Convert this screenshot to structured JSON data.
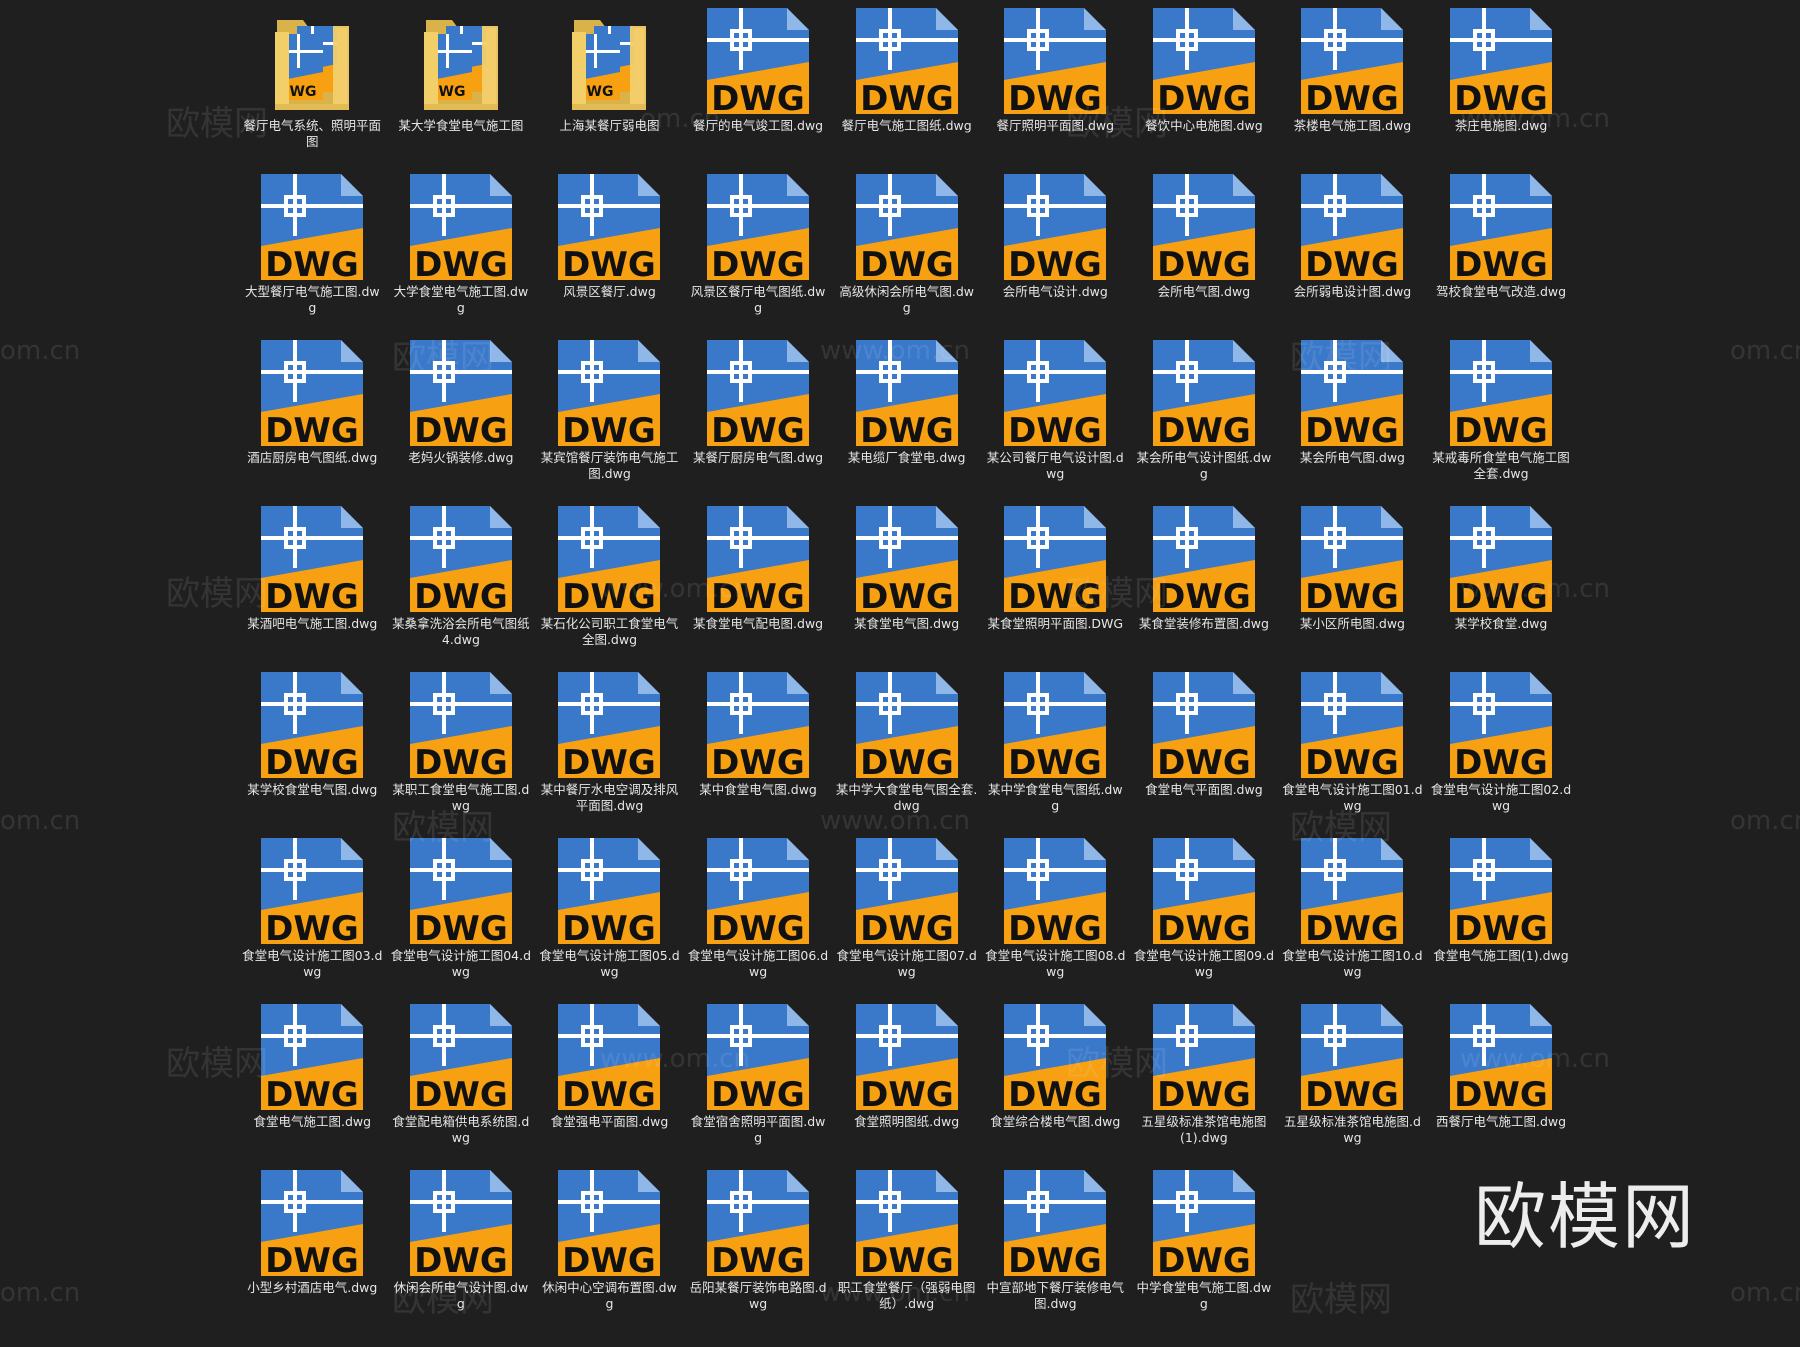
{
  "colors": {
    "background": "#1f1f1f",
    "dwg_blue": "#3a78c9",
    "dwg_orange": "#f7a012",
    "folder_yellow": "#f3cf6a"
  },
  "watermark": {
    "brand_text": "欧模网",
    "url_text": "www.om.cn",
    "url_fragment": "om.cn"
  },
  "files": [
    {
      "type": "folder",
      "name": "餐厅电气系统、照明平面图"
    },
    {
      "type": "folder",
      "name": "某大学食堂电气施工图"
    },
    {
      "type": "folder",
      "name": "上海某餐厅弱电图"
    },
    {
      "type": "dwg",
      "name": "餐厅的电气竣工图.dwg"
    },
    {
      "type": "dwg",
      "name": "餐厅电气施工图纸.dwg"
    },
    {
      "type": "dwg",
      "name": "餐厅照明平面图.dwg"
    },
    {
      "type": "dwg",
      "name": "餐饮中心电施图.dwg"
    },
    {
      "type": "dwg",
      "name": "茶楼电气施工图.dwg"
    },
    {
      "type": "dwg",
      "name": "茶庄电施图.dwg"
    },
    {
      "type": "dwg",
      "name": "大型餐厅电气施工图.dwg"
    },
    {
      "type": "dwg",
      "name": "大学食堂电气施工图.dwg"
    },
    {
      "type": "dwg",
      "name": "风景区餐厅.dwg"
    },
    {
      "type": "dwg",
      "name": "风景区餐厅电气图纸.dwg"
    },
    {
      "type": "dwg",
      "name": "高级休闲会所电气图.dwg"
    },
    {
      "type": "dwg",
      "name": "会所电气设计.dwg"
    },
    {
      "type": "dwg",
      "name": "会所电气图.dwg"
    },
    {
      "type": "dwg",
      "name": "会所弱电设计图.dwg"
    },
    {
      "type": "dwg",
      "name": "驾校食堂电气改造.dwg"
    },
    {
      "type": "dwg",
      "name": "酒店厨房电气图纸.dwg"
    },
    {
      "type": "dwg",
      "name": "老妈火锅装修.dwg"
    },
    {
      "type": "dwg",
      "name": "某宾馆餐厅装饰电气施工图.dwg"
    },
    {
      "type": "dwg",
      "name": "某餐厅厨房电气图.dwg"
    },
    {
      "type": "dwg",
      "name": "某电缆厂食堂电.dwg"
    },
    {
      "type": "dwg",
      "name": "某公司餐厅电气设计图.dwg"
    },
    {
      "type": "dwg",
      "name": "某会所电气设计图纸.dwg"
    },
    {
      "type": "dwg",
      "name": "某会所电气图.dwg"
    },
    {
      "type": "dwg",
      "name": "某戒毒所食堂电气施工图全套.dwg"
    },
    {
      "type": "dwg",
      "name": "某酒吧电气施工图.dwg"
    },
    {
      "type": "dwg",
      "name": "某桑拿洗浴会所电气图纸4.dwg"
    },
    {
      "type": "dwg",
      "name": "某石化公司职工食堂电气全图.dwg"
    },
    {
      "type": "dwg",
      "name": "某食堂电气配电图.dwg"
    },
    {
      "type": "dwg",
      "name": "某食堂电气图.dwg"
    },
    {
      "type": "dwg",
      "name": "某食堂照明平面图.DWG"
    },
    {
      "type": "dwg",
      "name": "某食堂装修布置图.dwg"
    },
    {
      "type": "dwg",
      "name": "某小区所电图.dwg"
    },
    {
      "type": "dwg",
      "name": "某学校食堂.dwg"
    },
    {
      "type": "dwg",
      "name": "某学校食堂电气图.dwg"
    },
    {
      "type": "dwg",
      "name": "某职工食堂电气施工图.dwg"
    },
    {
      "type": "dwg",
      "name": "某中餐厅水电空调及排风平面图.dwg"
    },
    {
      "type": "dwg",
      "name": "某中食堂电气图.dwg"
    },
    {
      "type": "dwg",
      "name": "某中学大食堂电气图全套.dwg"
    },
    {
      "type": "dwg",
      "name": "某中学食堂电气图纸.dwg"
    },
    {
      "type": "dwg",
      "name": "食堂电气平面图.dwg"
    },
    {
      "type": "dwg",
      "name": "食堂电气设计施工图01.dwg"
    },
    {
      "type": "dwg",
      "name": "食堂电气设计施工图02.dwg"
    },
    {
      "type": "dwg",
      "name": "食堂电气设计施工图03.dwg"
    },
    {
      "type": "dwg",
      "name": "食堂电气设计施工图04.dwg"
    },
    {
      "type": "dwg",
      "name": "食堂电气设计施工图05.dwg"
    },
    {
      "type": "dwg",
      "name": "食堂电气设计施工图06.dwg"
    },
    {
      "type": "dwg",
      "name": "食堂电气设计施工图07.dwg"
    },
    {
      "type": "dwg",
      "name": "食堂电气设计施工图08.dwg"
    },
    {
      "type": "dwg",
      "name": "食堂电气设计施工图09.dwg"
    },
    {
      "type": "dwg",
      "name": "食堂电气设计施工图10.dwg"
    },
    {
      "type": "dwg",
      "name": "食堂电气施工图(1).dwg"
    },
    {
      "type": "dwg",
      "name": "食堂电气施工图.dwg"
    },
    {
      "type": "dwg",
      "name": "食堂配电箱供电系统图.dwg"
    },
    {
      "type": "dwg",
      "name": "食堂强电平面图.dwg"
    },
    {
      "type": "dwg",
      "name": "食堂宿舍照明平面图.dwg"
    },
    {
      "type": "dwg",
      "name": "食堂照明图纸.dwg"
    },
    {
      "type": "dwg",
      "name": "食堂综合楼电气图.dwg"
    },
    {
      "type": "dwg",
      "name": "五星级标准茶馆电施图(1).dwg"
    },
    {
      "type": "dwg",
      "name": "五星级标准茶馆电施图.dwg"
    },
    {
      "type": "dwg",
      "name": "西餐厅电气施工图.dwg"
    },
    {
      "type": "dwg",
      "name": "小型乡村酒店电气.dwg"
    },
    {
      "type": "dwg",
      "name": "休闲会所电气设计图.dwg"
    },
    {
      "type": "dwg",
      "name": "休闲中心空调布置图.dwg"
    },
    {
      "type": "dwg",
      "name": "岳阳某餐厅装饰电路图.dwg"
    },
    {
      "type": "dwg",
      "name": "职工食堂餐厅（强弱电图纸）.dwg"
    },
    {
      "type": "dwg",
      "name": "中宣部地下餐厅装修电气图.dwg"
    },
    {
      "type": "dwg",
      "name": "中学食堂电气施工图.dwg"
    }
  ]
}
